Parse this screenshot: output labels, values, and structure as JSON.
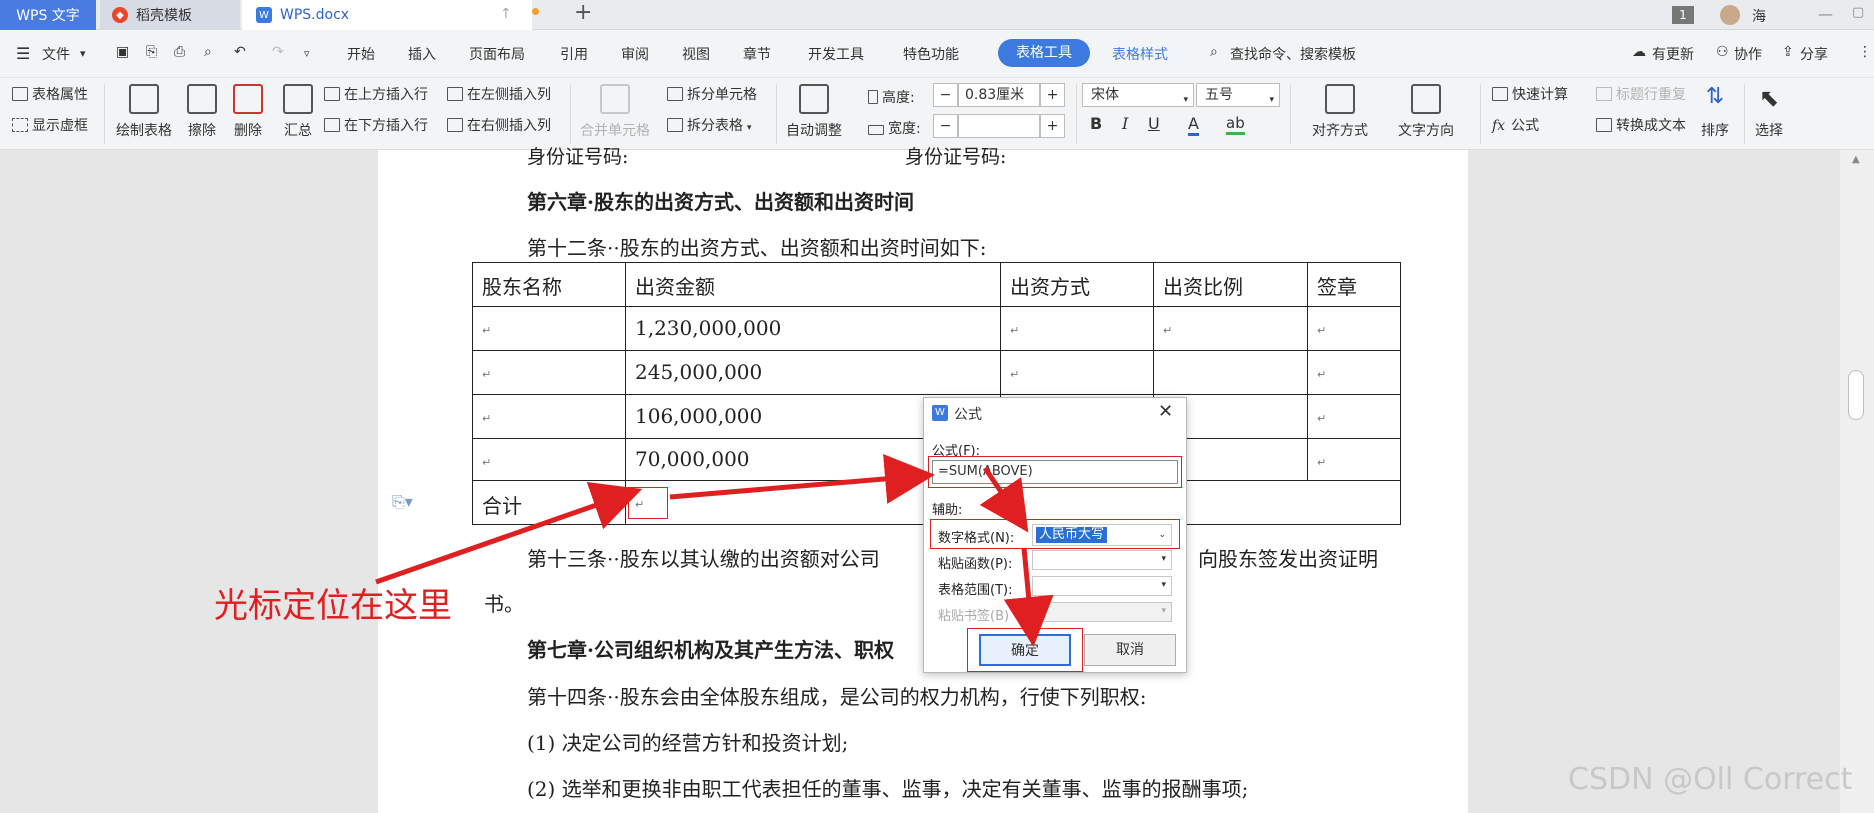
{
  "tabs": {
    "app": "WPS 文字",
    "templates": "稻壳模板",
    "document": "WPS.docx",
    "new_tab": "+"
  },
  "window": {
    "badge": "1",
    "user": "海"
  },
  "menu": {
    "file": "文件",
    "items": [
      "开始",
      "插入",
      "页面布局",
      "引用",
      "审阅",
      "视图",
      "章节",
      "开发工具",
      "特色功能",
      "表格工具",
      "表格样式"
    ],
    "search": "查找命令、搜索模板",
    "update": "有更新",
    "collab": "协作",
    "share": "分享"
  },
  "ribbon": {
    "table_props": "表格属性",
    "show_grid": "显示虚框",
    "draw_table": "绘制表格",
    "erase": "擦除",
    "delete": "删除",
    "summary": "汇总",
    "insert_above": "在上方插入行",
    "insert_below": "在下方插入行",
    "insert_left": "在左侧插入列",
    "insert_right": "在右侧插入列",
    "merge_cells": "合并单元格",
    "split_cells": "拆分单元格",
    "split_table": "拆分表格",
    "auto_fit": "自动调整",
    "height_label": "高度:",
    "height_value": "0.83厘米",
    "width_label": "宽度:",
    "width_value": "",
    "font": "宋体",
    "size": "五号",
    "bold": "B",
    "italic": "I",
    "underline": "U",
    "font_color": "A",
    "highlight": "ab",
    "align": "对齐方式",
    "text_dir": "文字方向",
    "quick_calc": "快速计算",
    "formula": "公式",
    "title_repeat": "标题行重复",
    "to_text": "转换成文本",
    "sort": "排序",
    "select": "选择"
  },
  "document": {
    "top_partial_1": "身份证号码:",
    "top_partial_2": "身份证号码:",
    "ch6": "第六章·股东的出资方式、出资额和出资时间",
    "art12": "第十二条··股东的出资方式、出资额和出资时间如下:",
    "art13a": "第十三条··股东以其认缴的出资额对公司",
    "art13b": "向股东签发出资证明",
    "art13c": "书。",
    "ch7": "第七章·公司组织机构及其产生方法、职权",
    "art14": "第十四条··股东会由全体股东组成，是公司的权力机构，行使下列职权:",
    "item1": "(1) 决定公司的经营方针和投资计划;",
    "item2": "(2) 选举和更换非由职工代表担任的董事、监事，决定有关董事、监事的报酬事项;"
  },
  "table": {
    "headers": [
      "股东名称",
      "出资金额",
      "出资方式",
      "出资比例",
      "签章"
    ],
    "amounts": [
      "1,230,000,000",
      "245,000,000",
      "106,000,000",
      "70,000,000"
    ],
    "total_label": "合计"
  },
  "dialog": {
    "title": "公式",
    "formula_label": "公式(F):",
    "formula_value": "=SUM(ABOVE)",
    "aux_label": "辅助:",
    "number_format_label": "数字格式(N):",
    "number_format_value": "人民币大写",
    "paste_func_label": "粘贴函数(P):",
    "table_range_label": "表格范围(T):",
    "paste_bookmark_label": "粘贴书签(B)",
    "ok": "确定",
    "cancel": "取消"
  },
  "annotation": {
    "caption": "光标定位在这里",
    "color": "#e02020"
  },
  "watermark": "CSDN @Oll Correct"
}
